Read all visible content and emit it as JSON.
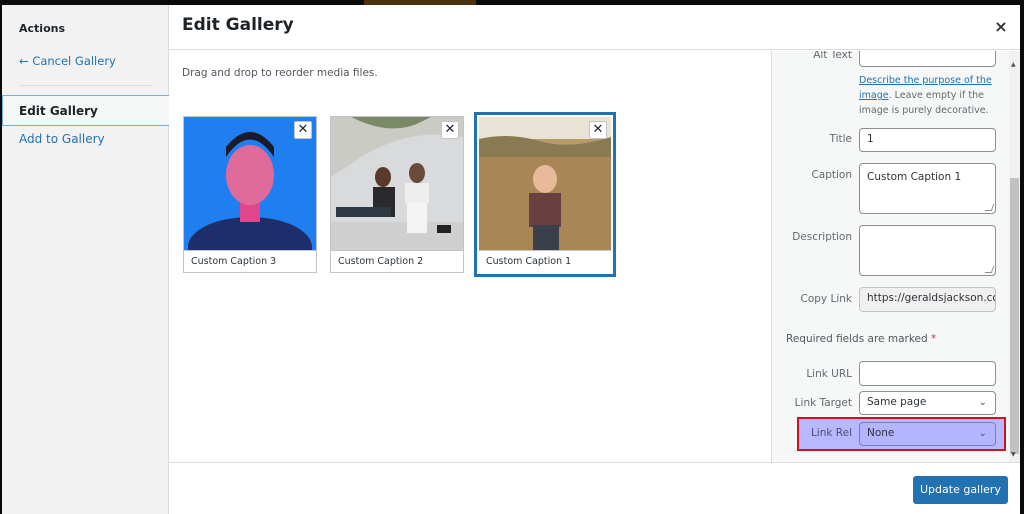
{
  "menu": {
    "heading": "Actions",
    "cancel": "← Cancel Gallery",
    "items": [
      {
        "label": "Edit Gallery",
        "active": true
      },
      {
        "label": "Add to Gallery",
        "active": false
      }
    ]
  },
  "title": "Edit Gallery",
  "close_icon": "×",
  "instructions": "Drag and drop to reorder media files.",
  "attachments": [
    {
      "caption": "Custom Caption 3",
      "image": "man-laughing-blue-background",
      "selected": false
    },
    {
      "caption": "Custom Caption 2",
      "image": "two-women-sitting-by-wall",
      "selected": false
    },
    {
      "caption": "Custom Caption 1",
      "image": "child-in-field",
      "selected": true
    }
  ],
  "remove_icon": "✕",
  "details": {
    "alt_text": {
      "label": "Alt Text",
      "value": ""
    },
    "alt_help_link": "Describe the purpose of the image",
    "alt_help_rest": ". Leave empty if the image is purely decorative.",
    "title": {
      "label": "Title",
      "value": "1"
    },
    "caption": {
      "label": "Caption",
      "value": "Custom Caption 1"
    },
    "description": {
      "label": "Description",
      "value": ""
    },
    "copy_link": {
      "label": "Copy Link",
      "value": "https://geraldsjackson.com"
    },
    "required_note": "Required fields are marked",
    "required_star": "*",
    "link_url": {
      "label": "Link URL",
      "value": ""
    },
    "link_target": {
      "label": "Link Target",
      "value": "Same page"
    },
    "link_rel": {
      "label": "Link Rel",
      "value": "None"
    }
  },
  "chevron": "⌄",
  "scroll": {
    "up": "▲",
    "down": "▼"
  },
  "toolbar": {
    "update_label": "Update gallery"
  },
  "colors": {
    "accent": "#2271b1",
    "highlight_border": "#d3101e",
    "highlight_fill": "#b7b8ff"
  }
}
